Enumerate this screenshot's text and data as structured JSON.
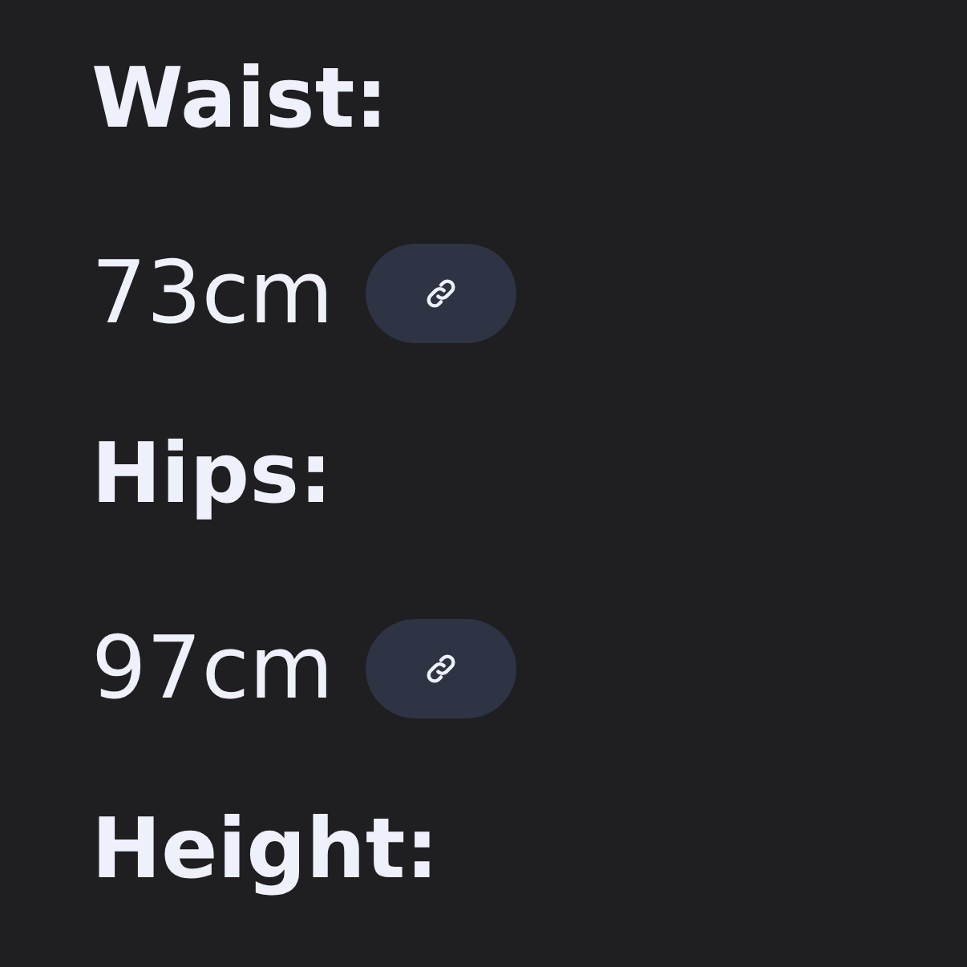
{
  "measurements": [
    {
      "label": "Waist:",
      "value": "73cm"
    },
    {
      "label": "Hips:",
      "value": "97cm"
    },
    {
      "label": "Height:"
    }
  ]
}
